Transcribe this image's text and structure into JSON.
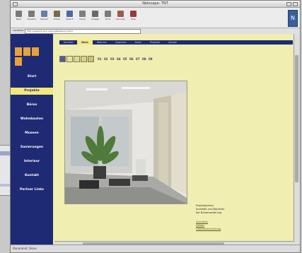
{
  "window": {
    "title": "Netscape: TNT"
  },
  "toolbar": {
    "buttons": [
      {
        "label": "Back",
        "color": "#7a7a7a"
      },
      {
        "label": "Forward",
        "color": "#7a7a7a"
      },
      {
        "label": "Reload",
        "color": "#6a7fa8"
      },
      {
        "label": "Home",
        "color": "#7d6a4a"
      },
      {
        "label": "Search",
        "color": "#4a6a9e"
      },
      {
        "label": "Guide",
        "color": "#7e7e7e"
      },
      {
        "label": "Images",
        "color": "#6a6a6a"
      },
      {
        "label": "Print",
        "color": "#7a7a7a"
      },
      {
        "label": "Security",
        "color": "#a05a4a"
      },
      {
        "label": "Stop",
        "color": "#9a3a3a"
      }
    ],
    "logo_glyph": "N"
  },
  "urlbar": {
    "label": "Location:",
    "value": "http://www.tnt-arch.de/projekte/buero.html"
  },
  "site": {
    "logo_colors": [
      "#e8a23c",
      "#e8a23c",
      "#e8a23c",
      "#e8a23c"
    ],
    "tabs": [
      "Kontakt",
      "Büro",
      "Wohnen",
      "Gewerbe",
      "Hotel",
      "Projekte",
      "Aktuell"
    ],
    "active_tab_index": 1,
    "nav": [
      "Start",
      "Projekte",
      "Büros",
      "Wohnbauten",
      "Museen",
      "Sanierungen",
      "Interieur",
      "Kontakt",
      "Partner Links"
    ],
    "active_nav_index": 1,
    "subnav": {
      "squares": [
        {
          "color": "#4a5aa8"
        },
        {
          "color": "#e9e4a0"
        },
        {
          "color": "#dcd898"
        },
        {
          "color": "#d6d08c"
        },
        {
          "color": "#c9c07a"
        }
      ],
      "numbers": [
        "01",
        "02",
        "03",
        "04",
        "05",
        "06",
        "07",
        "08",
        "09"
      ]
    },
    "caption": [
      "Projektpartner",
      "Architekt und Bauleiter",
      "der Büroerweiterung"
    ],
    "links": [
      "Grundriss",
      "Details",
      "Objektbeschreibung"
    ]
  },
  "statusbar": {
    "text": "Document: Done"
  },
  "colors": {
    "navy": "#1e2a74",
    "yellow": "#f2e97a",
    "page_bg": "#f0eeb0"
  }
}
